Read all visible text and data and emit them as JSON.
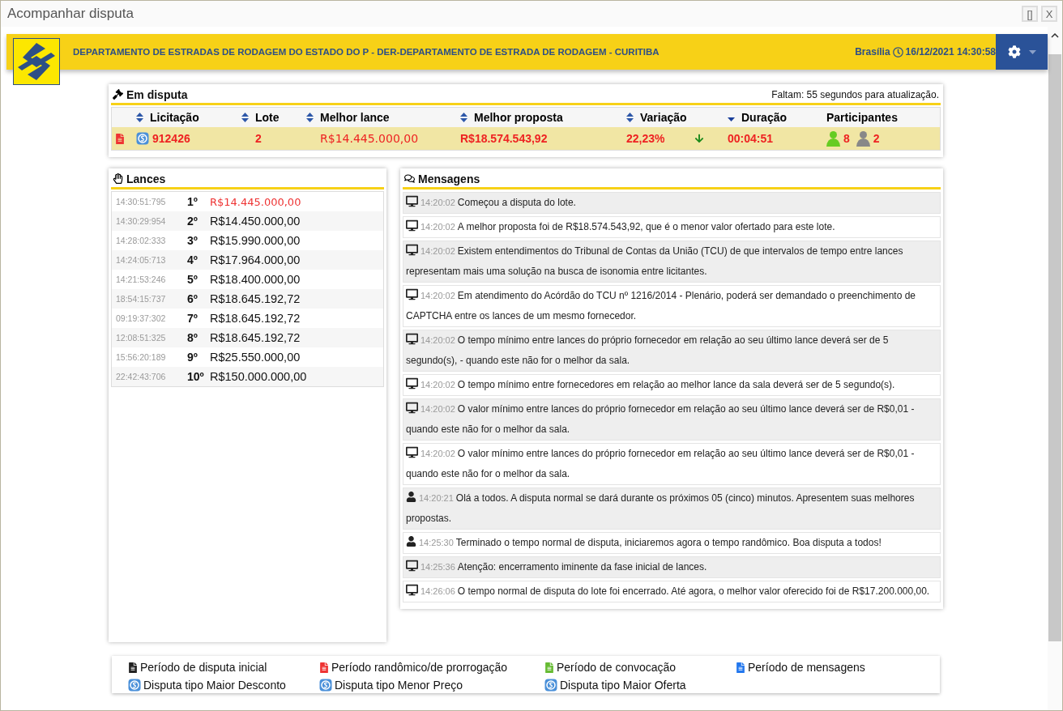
{
  "window": {
    "title": "Acompanhar disputa",
    "buttons": [
      "[]",
      "X"
    ]
  },
  "header": {
    "organization": "DEPARTAMENTO DE ESTRADAS DE RODAGEM DO ESTADO DO P - DER-DEPARTAMENTO DE ESTRADA DE RODAGEM - CURITIBA",
    "timezone": "Brasília",
    "datetime": "16/12/2021 14:30:58"
  },
  "em_disputa": {
    "title": "Em disputa",
    "countdown": "Faltam: 55 segundos para atualização.",
    "columns": [
      {
        "label": "Licitação",
        "sortable": true,
        "sorted": false
      },
      {
        "label": "Lote",
        "sortable": true,
        "sorted": false
      },
      {
        "label": "Melhor lance",
        "sortable": true,
        "sorted": false
      },
      {
        "label": "Melhor proposta",
        "sortable": true,
        "sorted": false
      },
      {
        "label": "Variação",
        "sortable": true,
        "sorted": false
      },
      {
        "label": "Duração",
        "sortable": true,
        "sorted": true
      },
      {
        "label": "Participantes",
        "sortable": false,
        "sorted": false
      }
    ],
    "rows": [
      {
        "licitacao": "912426",
        "lote": "2",
        "melhor_lance": "R$14.445.000,00",
        "melhor_proposta": "R$18.574.543,92",
        "variacao": "22,23%",
        "duracao": "00:04:51",
        "participants": [
          {
            "count": "8",
            "color": "#66cc22"
          },
          {
            "count": "2",
            "color": "#888888"
          }
        ]
      }
    ]
  },
  "lances": {
    "title": "Lances",
    "rows": [
      {
        "time": "14:30:51:795",
        "rank": "1º",
        "value": "R$14.445.000,00",
        "leading": true
      },
      {
        "time": "14:30:29:954",
        "rank": "2º",
        "value": "R$14.450.000,00",
        "leading": false
      },
      {
        "time": "14:28:02:333",
        "rank": "3º",
        "value": "R$15.990.000,00",
        "leading": false
      },
      {
        "time": "14:24:05:713",
        "rank": "4º",
        "value": "R$17.964.000,00",
        "leading": false
      },
      {
        "time": "14:21:53:246",
        "rank": "5º",
        "value": "R$18.400.000,00",
        "leading": false
      },
      {
        "time": "18:54:15:737",
        "rank": "6º",
        "value": "R$18.645.192,72",
        "leading": false
      },
      {
        "time": "09:19:37:302",
        "rank": "7º",
        "value": "R$18.645.192,72",
        "leading": false
      },
      {
        "time": "12:08:51:325",
        "rank": "8º",
        "value": "R$18.645.192,72",
        "leading": false
      },
      {
        "time": "15:56:20:189",
        "rank": "9º",
        "value": "R$25.550.000,00",
        "leading": false
      },
      {
        "time": "22:42:43:706",
        "rank": "10º",
        "value": "R$150.000.000,00",
        "leading": false
      }
    ]
  },
  "mensagens": {
    "title": "Mensagens",
    "items": [
      {
        "kind": "system",
        "time": "14:20:02",
        "text": "Começou a disputa do lote."
      },
      {
        "kind": "system",
        "time": "14:20:02",
        "text": "A melhor proposta foi de R$18.574.543,92, que é o menor valor ofertado para este lote."
      },
      {
        "kind": "system",
        "time": "14:20:02",
        "text": "Existem entendimentos do Tribunal de Contas da União (TCU) de que intervalos de tempo entre lances representam mais uma solução na busca de isonomia entre licitantes."
      },
      {
        "kind": "system",
        "time": "14:20:02",
        "text": "Em atendimento do Acórdão do TCU nº 1216/2014 - Plenário, poderá ser demandado o preenchimento de CAPTCHA entre os lances de um mesmo fornecedor."
      },
      {
        "kind": "system",
        "time": "14:20:02",
        "text": "O tempo mínimo entre lances do próprio fornecedor em relação ao seu último lance deverá ser de 5 segundo(s), - quando este não for o melhor da sala."
      },
      {
        "kind": "system",
        "time": "14:20:02",
        "text": "O tempo mínimo entre fornecedores em relação ao melhor lance da sala deverá ser de 5 segundo(s)."
      },
      {
        "kind": "system",
        "time": "14:20:02",
        "text": "O valor mínimo entre lances do próprio fornecedor em relação ao seu último lance deverá ser de R$0,01 - quando este não for o melhor da sala."
      },
      {
        "kind": "system",
        "time": "14:20:02",
        "text": "O valor mínimo entre lances do próprio fornecedor em relação ao seu último lance deverá ser de R$0,01 - quando este não for o melhor da sala."
      },
      {
        "kind": "user",
        "time": "14:20:21",
        "text": "Olá a todos. A disputa normal se dará durante os próximos 05 (cinco) minutos. Apresentem suas melhores propostas."
      },
      {
        "kind": "user",
        "time": "14:25:30",
        "text": "Terminado o tempo normal de disputa, iniciaremos agora o tempo randômico. Boa disputa a todos!"
      },
      {
        "kind": "system",
        "time": "14:25:36",
        "text": "Atenção: encerramento iminente da fase inicial de lances."
      },
      {
        "kind": "system",
        "time": "14:26:06",
        "text": "O tempo normal de disputa do lote foi encerrado. Até agora, o melhor valor oferecido foi de R$17.200.000,00."
      }
    ]
  },
  "legend": [
    {
      "kind": "period",
      "color": "#222222",
      "label": "Período de disputa inicial"
    },
    {
      "kind": "period",
      "color": "#ee3333",
      "label": "Período randômico/de prorrogação"
    },
    {
      "kind": "period",
      "color": "#66bb33",
      "label": "Período de convocação"
    },
    {
      "kind": "period",
      "color": "#2277ee",
      "label": "Período de mensagens"
    },
    {
      "kind": "dispute_type",
      "color": "#4a90d9",
      "label": "Disputa tipo Maior Desconto"
    },
    {
      "kind": "dispute_type",
      "color": "#4a90d9",
      "label": "Disputa tipo Menor Preço"
    },
    {
      "kind": "dispute_type",
      "color": "#4a90d9",
      "label": "Disputa tipo Maior Oferta"
    }
  ]
}
